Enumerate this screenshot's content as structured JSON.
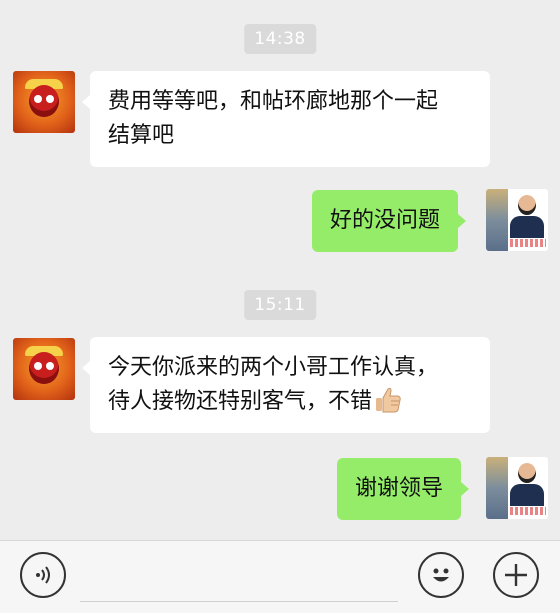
{
  "messages": [
    {
      "type": "time",
      "text": "14:38"
    },
    {
      "type": "received",
      "text": "费用等等吧，和帖环廊地那个一起结算吧",
      "line1": "费用等等吧，和帖环廊地那个一起",
      "line2": "结算吧"
    },
    {
      "type": "sent",
      "text": "好的没问题"
    },
    {
      "type": "time",
      "text": "15:11"
    },
    {
      "type": "received",
      "line1": "今天你派来的两个小哥工作认真，",
      "line2": "待人接物还特别客气，不错",
      "emoji": "thumbs-up"
    },
    {
      "type": "sent",
      "text": "谢谢领导"
    }
  ],
  "colors": {
    "background": "#ededed",
    "sent_bubble": "#95ec69",
    "received_bubble": "#ffffff",
    "time_badge": "#dadada"
  },
  "icons": {
    "voice": "voice-icon",
    "emoji": "emoji-icon",
    "plus": "plus-icon"
  }
}
